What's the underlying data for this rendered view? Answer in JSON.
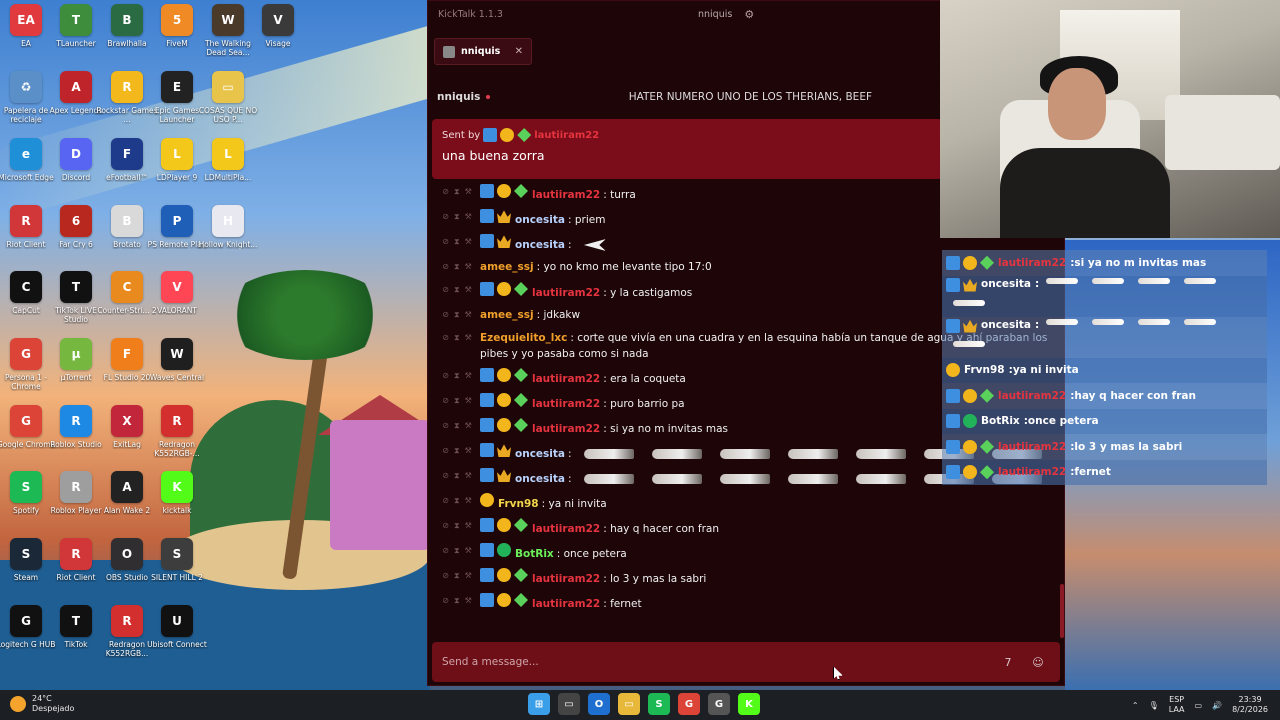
{
  "desktop": {
    "icons": [
      {
        "label": "EA",
        "color": "#e03a3e",
        "glyph": "EA"
      },
      {
        "label": "TLauncher",
        "color": "#3d8d3d",
        "glyph": "T"
      },
      {
        "label": "Brawlhalla",
        "color": "#2b6b44",
        "glyph": "B"
      },
      {
        "label": "FiveM",
        "color": "#f08a24",
        "glyph": "5"
      },
      {
        "label": "The Walking Dead Sea...",
        "color": "#4a3a2a",
        "glyph": "W"
      },
      {
        "label": "Visage",
        "color": "#3a3a3a",
        "glyph": "V"
      },
      {
        "label": "Papelera de reciclaje",
        "color": "#5a8fc8",
        "glyph": "♻"
      },
      {
        "label": "Apex Legends",
        "color": "#c0242b",
        "glyph": "A"
      },
      {
        "label": "Rockstar Games ...",
        "color": "#f3b81b",
        "glyph": "R"
      },
      {
        "label": "Epic Games Launcher",
        "color": "#222222",
        "glyph": "E"
      },
      {
        "label": "COSAS QUE NO USO P...",
        "color": "#e8c44a",
        "glyph": "▭"
      },
      {
        "label": "Microsoft Edge",
        "color": "#1f8fd8",
        "glyph": "e"
      },
      {
        "label": "Discord",
        "color": "#5865f2",
        "glyph": "D"
      },
      {
        "label": "eFootball™",
        "color": "#1e3a8a",
        "glyph": "F"
      },
      {
        "label": "LDPlayer 9",
        "color": "#f3c81b",
        "glyph": "L"
      },
      {
        "label": "LDMultiPla...",
        "color": "#f3c81b",
        "glyph": "L"
      },
      {
        "label": "Riot Client",
        "color": "#d13639",
        "glyph": "R"
      },
      {
        "label": "Far Cry 6",
        "color": "#b8281e",
        "glyph": "6"
      },
      {
        "label": "Brotato",
        "color": "#d9d9d9",
        "glyph": "B"
      },
      {
        "label": "PS Remote Play",
        "color": "#1f5fb8",
        "glyph": "P"
      },
      {
        "label": "Hollow Knight...",
        "color": "#e8e8f0",
        "glyph": "H"
      },
      {
        "label": "CapCut",
        "color": "#111111",
        "glyph": "C"
      },
      {
        "label": "TikTok LIVE Studio",
        "color": "#111111",
        "glyph": "T"
      },
      {
        "label": "Counter-Stri... 2",
        "color": "#e88a1e",
        "glyph": "C"
      },
      {
        "label": "VALORANT",
        "color": "#ff4655",
        "glyph": "V"
      },
      {
        "label": "Persona 1 - Chrome",
        "color": "#db4437",
        "glyph": "G"
      },
      {
        "label": "µTorrent",
        "color": "#76b83f",
        "glyph": "µ"
      },
      {
        "label": "FL Studio 20",
        "color": "#f07f1b",
        "glyph": "F"
      },
      {
        "label": "Waves Central",
        "color": "#1f1f1f",
        "glyph": "W"
      },
      {
        "label": "Google Chrome",
        "color": "#db4437",
        "glyph": "G"
      },
      {
        "label": "Roblox Studio",
        "color": "#1e88e5",
        "glyph": "R"
      },
      {
        "label": "ExitLag",
        "color": "#c2263a",
        "glyph": "X"
      },
      {
        "label": "Redragon K552RGB-...",
        "color": "#d32f2f",
        "glyph": "R"
      },
      {
        "label": "Spotify",
        "color": "#1db954",
        "glyph": "S"
      },
      {
        "label": "Roblox Player",
        "color": "#9e9e9e",
        "glyph": "R"
      },
      {
        "label": "Alan Wake 2",
        "color": "#222222",
        "glyph": "A"
      },
      {
        "label": "kicktalk",
        "color": "#53fc18",
        "glyph": "K"
      },
      {
        "label": "Steam",
        "color": "#1b2838",
        "glyph": "S"
      },
      {
        "label": "Riot Client",
        "color": "#d13639",
        "glyph": "R"
      },
      {
        "label": "OBS Studio",
        "color": "#302e31",
        "glyph": "O"
      },
      {
        "label": "SILENT HILL 2",
        "color": "#3d3d3d",
        "glyph": "S"
      },
      {
        "label": "Logitech G HUB",
        "color": "#111111",
        "glyph": "G"
      },
      {
        "label": "TikTok",
        "color": "#111111",
        "glyph": "T"
      },
      {
        "label": "Redragon K552RGB...",
        "color": "#d32f2f",
        "glyph": "R"
      },
      {
        "label": "Ubisoft Connect",
        "color": "#111111",
        "glyph": "U"
      }
    ]
  },
  "kicktalk": {
    "app_title": "KickTalk 1.1.3",
    "current_user": "nniquis",
    "tab_label": "nniquis",
    "channel_name": "nniquis",
    "channel_topic": "HATER NUMERO UNO DE LOS THERIANS, BEEF",
    "pinned": {
      "sent_by_label": "Sent by",
      "sender": "lautiiram22",
      "message": "una buena zorra"
    },
    "input_placeholder": "Send a message...",
    "messages": [
      {
        "badges": [
          "mod",
          "sub",
          "vip"
        ],
        "user": "lautiiram22",
        "color": "#e5343f",
        "text": "turra"
      },
      {
        "badges": [
          "mod",
          "crown"
        ],
        "user": "oncesita",
        "color": "#b9d3ff",
        "text": "priem"
      },
      {
        "badges": [
          "mod",
          "crown"
        ],
        "user": "oncesita",
        "color": "#b9d3ff",
        "text": "",
        "emote_small": true
      },
      {
        "badges": [],
        "user": "amee_ssj",
        "color": "#f0a02a",
        "text": "yo no kmo me levante tipo 17:0"
      },
      {
        "badges": [
          "mod",
          "sub",
          "vip"
        ],
        "user": "lautiiram22",
        "color": "#e5343f",
        "text": "y la castigamos"
      },
      {
        "badges": [],
        "user": "amee_ssj",
        "color": "#f0a02a",
        "text": "jdkakw"
      },
      {
        "badges": [],
        "user": "Ezequielito_lxc",
        "color": "#f0a02a",
        "text": "corte que vivía en una cuadra y en la esquina había un tanque de agua y ahí paraban los pibes y yo pasaba como si nada"
      },
      {
        "badges": [
          "mod",
          "sub",
          "vip"
        ],
        "user": "lautiiram22",
        "color": "#e5343f",
        "text": "era la coqueta"
      },
      {
        "badges": [
          "mod",
          "sub",
          "vip"
        ],
        "user": "lautiiram22",
        "color": "#e5343f",
        "text": "puro barrio pa"
      },
      {
        "badges": [
          "mod",
          "sub",
          "vip"
        ],
        "user": "lautiiram22",
        "color": "#e5343f",
        "text": "si ya no m invitas mas"
      },
      {
        "badges": [
          "mod",
          "crown"
        ],
        "user": "oncesita",
        "color": "#b9d3ff",
        "text": "",
        "emotes": 7
      },
      {
        "badges": [
          "mod",
          "crown"
        ],
        "user": "oncesita",
        "color": "#b9d3ff",
        "text": "",
        "emotes": 7
      },
      {
        "badges": [
          "sub"
        ],
        "user": "Frvn98",
        "color": "#f2d54b",
        "text": "ya ni invita"
      },
      {
        "badges": [
          "mod",
          "sub",
          "vip"
        ],
        "user": "lautiiram22",
        "color": "#e5343f",
        "text": "hay q hacer con fran"
      },
      {
        "badges": [
          "mod",
          "bot"
        ],
        "user": "BotRix",
        "color": "#6bf05a",
        "text": "once petera"
      },
      {
        "badges": [
          "mod",
          "sub",
          "vip"
        ],
        "user": "lautiiram22",
        "color": "#e5343f",
        "text": "lo 3 y mas la sabri"
      },
      {
        "badges": [
          "mod",
          "sub",
          "vip"
        ],
        "user": "lautiiram22",
        "color": "#e5343f",
        "text": "fernet"
      }
    ]
  },
  "overlay": {
    "messages": [
      {
        "badges": [
          "mod",
          "sub",
          "vip"
        ],
        "user": "lautiiram22",
        "color": "#e5343f",
        "text": "si ya no m invitas mas"
      },
      {
        "badges": [
          "mod",
          "crown"
        ],
        "user": "oncesita",
        "color": "#ffffff",
        "text": "",
        "emotes": 5
      },
      {
        "badges": [
          "mod",
          "crown"
        ],
        "user": "oncesita",
        "color": "#ffffff",
        "text": "",
        "emotes": 5
      },
      {
        "badges": [
          "sub"
        ],
        "user": "Frvn98",
        "color": "#ffffff",
        "text": "ya ni invita"
      },
      {
        "badges": [
          "mod",
          "sub",
          "vip"
        ],
        "user": "lautiiram22",
        "color": "#e5343f",
        "text": "hay q hacer con fran"
      },
      {
        "badges": [
          "mod",
          "bot"
        ],
        "user": "BotRix",
        "color": "#ffffff",
        "text": "once petera"
      },
      {
        "badges": [
          "mod",
          "sub",
          "vip"
        ],
        "user": "lautiiram22",
        "color": "#e5343f",
        "text": "lo 3 y mas la sabri"
      },
      {
        "badges": [
          "mod",
          "sub",
          "vip"
        ],
        "user": "lautiiram22",
        "color": "#e5343f",
        "text": "fernet"
      }
    ]
  },
  "taskbar": {
    "temperature": "24°C",
    "weather": "Despejado",
    "lang_line1": "ESP",
    "lang_line2": "LAA",
    "time": "23:39",
    "date": "8/2/2026",
    "apps": [
      {
        "name": "start-icon",
        "color": "#3a9ee8",
        "glyph": "⊞"
      },
      {
        "name": "task-view-icon",
        "color": "#444444",
        "glyph": "▭"
      },
      {
        "name": "outlook-icon",
        "color": "#1f6fd0",
        "glyph": "O"
      },
      {
        "name": "file-explorer-icon",
        "color": "#e8b83a",
        "glyph": "▭"
      },
      {
        "name": "spotify-icon",
        "color": "#1db954",
        "glyph": "S"
      },
      {
        "name": "chrome-icon",
        "color": "#db4437",
        "glyph": "G"
      },
      {
        "name": "chrome-persona-icon",
        "color": "#555555",
        "glyph": "G"
      },
      {
        "name": "kicktalk-icon",
        "color": "#53fc18",
        "glyph": "K"
      }
    ]
  }
}
